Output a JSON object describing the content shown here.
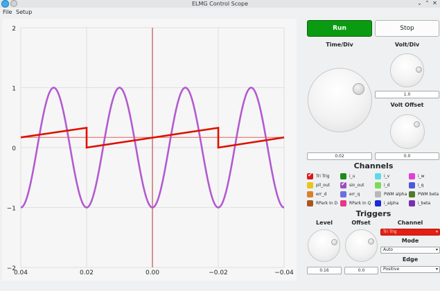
{
  "window": {
    "title": "ELMG Control Scope"
  },
  "menu": {
    "items": [
      "File",
      "Setup"
    ]
  },
  "scope": {
    "y_ticks": [
      "2",
      "1",
      "0",
      "−1",
      "−2"
    ],
    "x_ticks": [
      "−0.04",
      "−0.02",
      "0.00",
      "0.02",
      "0.04"
    ]
  },
  "chart_data": {
    "type": "line",
    "x_range": [
      -0.04,
      0.04
    ],
    "y_range": [
      -2,
      2
    ],
    "grid": true,
    "series": [
      {
        "color": "#b25ad0",
        "description_period": 0.02,
        "amplitude": 1.0,
        "phase_peak_at": -0.03
      },
      {
        "color": "#dd1100",
        "period": 0.04,
        "start": 0.17,
        "end": 0.33,
        "wrap_at": [
          -0.02,
          0.02
        ]
      },
      {
        "color": "#e06060",
        "constant": 0.17
      }
    ]
  },
  "controls": {
    "run_label": "Run",
    "stop_label": "Stop",
    "time_div_label": "Time/Div",
    "time_div_value": "0.02",
    "volt_div_label": "Volt/Div",
    "volt_div_value": "1.0",
    "volt_offset_label": "Volt Offset",
    "volt_offset_value": "0.0"
  },
  "channels": {
    "title": "Channels",
    "items": [
      {
        "label": "Tri Trig",
        "color": "#d81b1b",
        "checked": true
      },
      {
        "label": "i_u",
        "color": "#1a8c1a",
        "checked": false
      },
      {
        "label": "i_v",
        "color": "#5fd9e8",
        "checked": false
      },
      {
        "label": "i_w",
        "color": "#e03fd8",
        "checked": false
      },
      {
        "label": "pll_out",
        "color": "#e8c51c",
        "checked": false
      },
      {
        "label": "sin_out",
        "color": "#9a4fc0",
        "checked": true
      },
      {
        "label": "i_d",
        "color": "#7ed957",
        "checked": false
      },
      {
        "label": "i_q",
        "color": "#4a5ad8",
        "checked": false
      },
      {
        "label": "err_d",
        "color": "#d9822b",
        "checked": false
      },
      {
        "label": "err_q",
        "color": "#6c6fe0",
        "checked": false
      },
      {
        "label": "PWM alpha",
        "color": "#b8b8b8",
        "checked": false
      },
      {
        "label": "PWM beta",
        "color": "#4f7a2a",
        "checked": false
      },
      {
        "label": "RPark In D",
        "color": "#a8571f",
        "checked": false
      },
      {
        "label": "RPark In Q",
        "color": "#e8358a",
        "checked": false
      },
      {
        "label": "i_alpha",
        "color": "#1b2ad8",
        "checked": false
      },
      {
        "label": "i_beta",
        "color": "#7a2fb0",
        "checked": false
      }
    ]
  },
  "triggers": {
    "title": "Triggers",
    "level_label": "Level",
    "level_value": "0.16",
    "offset_label": "Offset",
    "offset_value": "0.0",
    "channel_label": "Channel",
    "channel_value": "Tri Trig",
    "mode_label": "Mode",
    "mode_value": "Auto",
    "edge_label": "Edge",
    "edge_value": "Positive"
  }
}
